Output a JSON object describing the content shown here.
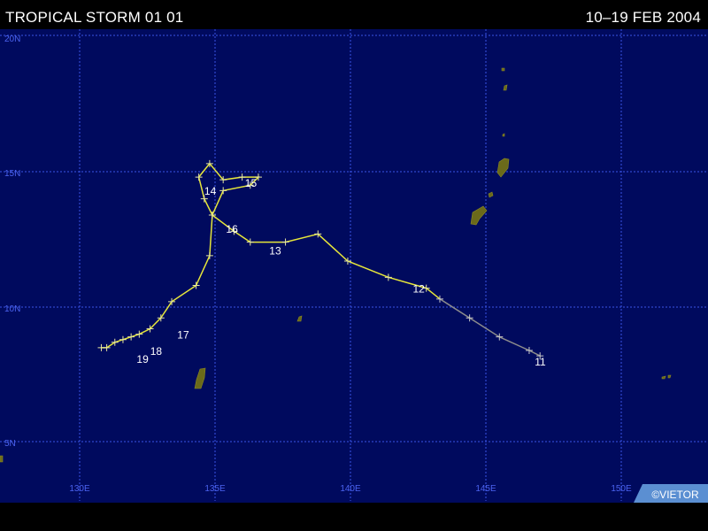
{
  "header": {
    "title": "TROPICAL STORM 01 01",
    "date_range": "10–19 FEB 2004"
  },
  "map": {
    "background_color": "#000a5e",
    "grid_color": "#3a54e6",
    "track_color": "#e6e63a",
    "forecast_track_color": "#8c8c8c",
    "land_color": "#6b6a1a",
    "lat_labels": [
      "20N",
      "15N",
      "10N",
      "5N"
    ],
    "lon_labels": [
      "130E",
      "135E",
      "140E",
      "145E",
      "150E"
    ]
  },
  "storm_track": {
    "day_labels": [
      {
        "day": "11",
        "lon": 147.0,
        "lat": 8.3
      },
      {
        "day": "12",
        "lon": 142.5,
        "lat": 11.0
      },
      {
        "day": "13",
        "lon": 137.2,
        "lat": 12.4
      },
      {
        "day": "14",
        "lon": 134.8,
        "lat": 14.6
      },
      {
        "day": "15",
        "lon": 136.3,
        "lat": 14.9
      },
      {
        "day": "16",
        "lon": 135.6,
        "lat": 13.2
      },
      {
        "day": "17",
        "lon": 133.8,
        "lat": 9.3
      },
      {
        "day": "18",
        "lon": 132.8,
        "lat": 8.7
      },
      {
        "day": "19",
        "lon": 132.3,
        "lat": 8.4
      }
    ],
    "track_points": [
      {
        "lon": 147.0,
        "lat": 8.2
      },
      {
        "lon": 146.6,
        "lat": 8.4
      },
      {
        "lon": 145.5,
        "lat": 8.9
      },
      {
        "lon": 144.4,
        "lat": 9.6
      },
      {
        "lon": 143.3,
        "lat": 10.3
      },
      {
        "lon": 142.8,
        "lat": 10.7
      },
      {
        "lon": 141.4,
        "lat": 11.1
      },
      {
        "lon": 139.9,
        "lat": 11.7
      },
      {
        "lon": 138.8,
        "lat": 12.7
      },
      {
        "lon": 137.6,
        "lat": 12.4
      },
      {
        "lon": 136.3,
        "lat": 12.4
      },
      {
        "lon": 135.7,
        "lat": 12.8
      },
      {
        "lon": 134.9,
        "lat": 13.4
      },
      {
        "lon": 135.3,
        "lat": 14.3
      },
      {
        "lon": 136.3,
        "lat": 14.5
      },
      {
        "lon": 136.6,
        "lat": 14.8
      },
      {
        "lon": 136.0,
        "lat": 14.8
      },
      {
        "lon": 135.3,
        "lat": 14.7
      },
      {
        "lon": 134.8,
        "lat": 15.3
      },
      {
        "lon": 134.4,
        "lat": 14.8
      },
      {
        "lon": 134.6,
        "lat": 14.0
      },
      {
        "lon": 134.9,
        "lat": 13.4
      },
      {
        "lon": 134.8,
        "lat": 11.9
      },
      {
        "lon": 134.3,
        "lat": 10.8
      },
      {
        "lon": 133.4,
        "lat": 10.2
      },
      {
        "lon": 133.0,
        "lat": 9.6
      },
      {
        "lon": 132.6,
        "lat": 9.2
      },
      {
        "lon": 132.2,
        "lat": 9.0
      },
      {
        "lon": 131.9,
        "lat": 8.9
      },
      {
        "lon": 131.6,
        "lat": 8.8
      },
      {
        "lon": 131.3,
        "lat": 8.7
      },
      {
        "lon": 131.0,
        "lat": 8.5
      },
      {
        "lon": 130.8,
        "lat": 8.5
      }
    ],
    "forecast_segment_points": 5
  },
  "credit": {
    "text": "©VIETOR"
  }
}
